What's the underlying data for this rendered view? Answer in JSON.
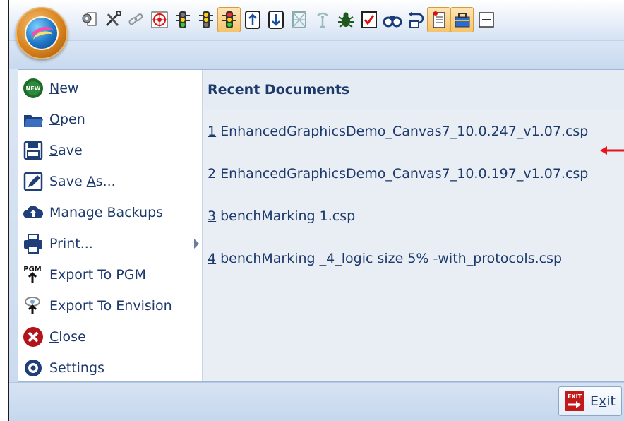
{
  "quick_access": {
    "buttons": [
      {
        "name": "gear-document-icon"
      },
      {
        "name": "tools-icon"
      },
      {
        "name": "link-icon"
      },
      {
        "name": "target-icon"
      },
      {
        "name": "traffic-light-green-icon"
      },
      {
        "name": "traffic-light-yellow-icon"
      },
      {
        "name": "traffic-light-red-icon",
        "active": true
      },
      {
        "name": "arrow-up-box-icon"
      },
      {
        "name": "arrow-down-box-icon"
      },
      {
        "name": "grid-tower-icon"
      },
      {
        "name": "antenna-icon"
      },
      {
        "name": "bug-icon"
      },
      {
        "name": "checkmark-box-icon"
      },
      {
        "name": "binoculars-icon"
      },
      {
        "name": "undo-arrow-icon"
      },
      {
        "name": "document-list-icon",
        "active": true
      },
      {
        "name": "toolbox-icon",
        "active": true
      },
      {
        "name": "minus-icon"
      }
    ]
  },
  "menu": {
    "items": [
      {
        "key": "new",
        "pre": "",
        "mnemonic": "N",
        "post": "ew",
        "icon": "new-badge-icon"
      },
      {
        "key": "open",
        "pre": "",
        "mnemonic": "O",
        "post": "pen",
        "icon": "folder-open-icon"
      },
      {
        "key": "save",
        "pre": "",
        "mnemonic": "S",
        "post": "ave",
        "icon": "floppy-disk-icon"
      },
      {
        "key": "save-as",
        "pre": "Save ",
        "mnemonic": "A",
        "post": "s...",
        "icon": "save-as-pencil-icon"
      },
      {
        "key": "manage-backups",
        "pre": "Manage Backups",
        "mnemonic": "",
        "post": "",
        "icon": "cloud-upload-icon"
      },
      {
        "key": "print",
        "pre": "",
        "mnemonic": "P",
        "post": "rint...",
        "icon": "printer-icon",
        "submenu": true
      },
      {
        "key": "export-pgm",
        "pre": "Export To PGM",
        "mnemonic": "",
        "post": "",
        "icon": "pgm-export-icon"
      },
      {
        "key": "export-envision",
        "pre": "Export To Envision",
        "mnemonic": "",
        "post": "",
        "icon": "envision-export-icon"
      },
      {
        "key": "close",
        "pre": "",
        "mnemonic": "C",
        "post": "lose",
        "icon": "close-x-icon"
      },
      {
        "key": "settings",
        "pre": "Settings",
        "mnemonic": "",
        "post": "",
        "icon": "settings-gear-icon"
      }
    ]
  },
  "recent": {
    "header": "Recent Documents",
    "items": [
      {
        "num": "1",
        "name": "EnhancedGraphicsDemo_Canvas7_10.0.247_v1.07.csp"
      },
      {
        "num": "2",
        "name": "EnhancedGraphicsDemo_Canvas7_10.0.197_v1.07.csp"
      },
      {
        "num": "3",
        "name": "benchMarking 1.csp"
      },
      {
        "num": "4",
        "name": "benchMarking _4_logic size 5% -with_protocols.csp"
      }
    ]
  },
  "exit": {
    "pre": "E",
    "mnemonic": "x",
    "post": "it",
    "icon": "exit-sign-icon"
  },
  "annotation": {
    "color": "#e8131b"
  }
}
